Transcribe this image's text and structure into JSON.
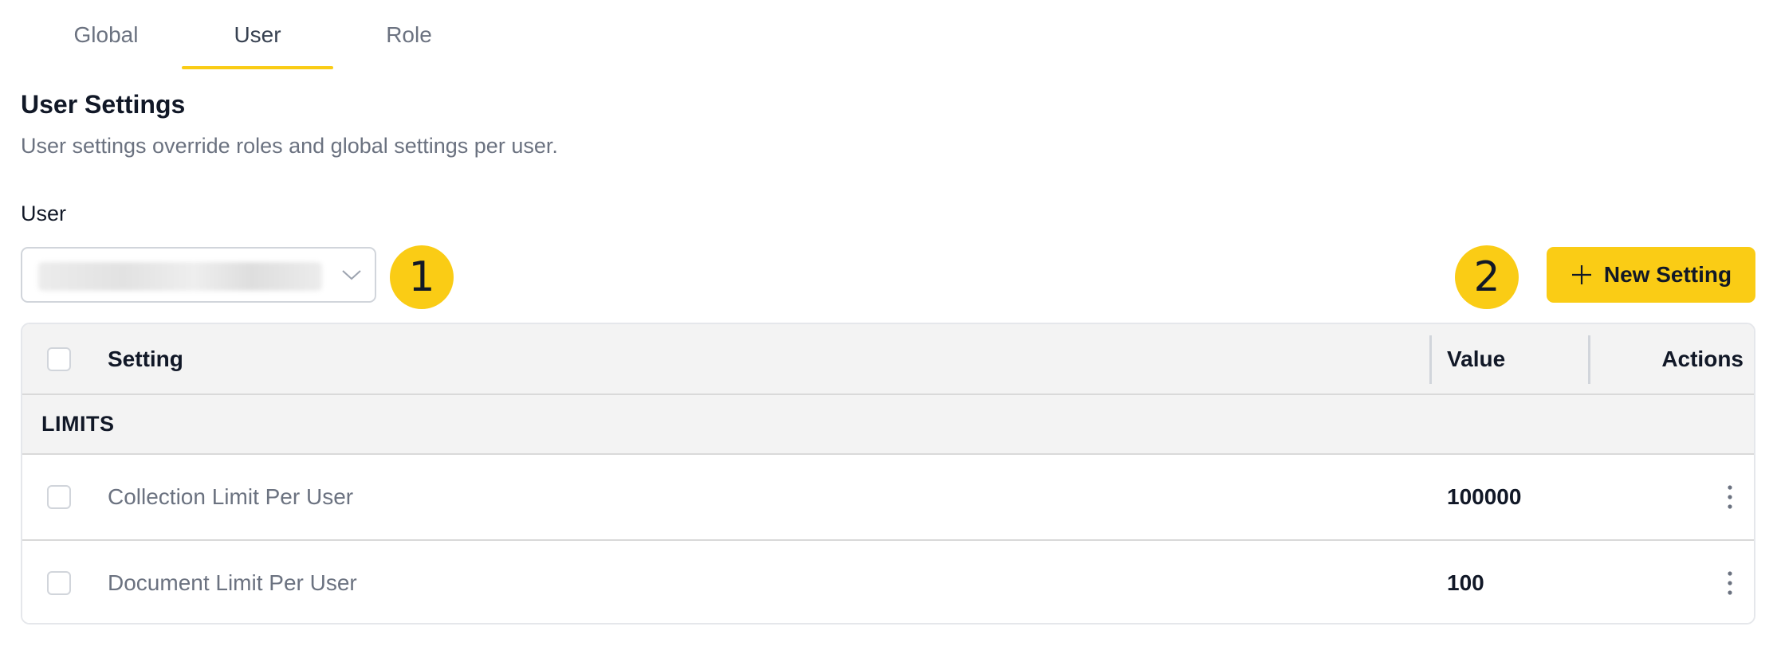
{
  "tabs": [
    {
      "label": "Global",
      "active": false
    },
    {
      "label": "User",
      "active": true
    },
    {
      "label": "Role",
      "active": false
    }
  ],
  "section": {
    "title": "User Settings",
    "description": "User settings override roles and global settings per user."
  },
  "user_field": {
    "label": "User",
    "value_obscured": true
  },
  "callouts": [
    "1",
    "2"
  ],
  "new_setting_button": {
    "label": "New Setting",
    "icon": "plus-icon"
  },
  "table": {
    "columns": {
      "setting": "Setting",
      "value": "Value",
      "actions": "Actions"
    },
    "group": "LIMITS",
    "rows": [
      {
        "setting": "Collection Limit Per User",
        "value": "100000"
      },
      {
        "setting": "Document Limit Per User",
        "value": "100"
      }
    ]
  },
  "colors": {
    "accent": "#facc15",
    "muted_text": "#6b7280",
    "header_bg": "#f3f3f3",
    "border": "#e5e7eb"
  }
}
